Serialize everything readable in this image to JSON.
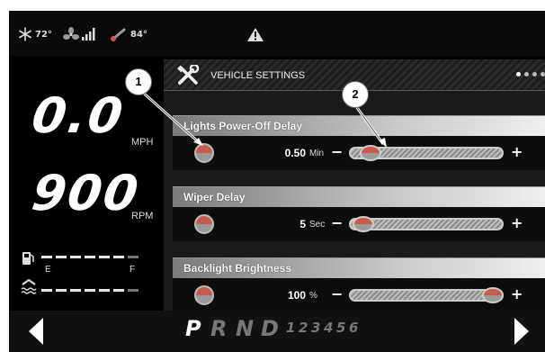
{
  "status_bar": {
    "cabin_temp": "72°",
    "outside_temp": "84°",
    "icons": [
      "snowflake-icon",
      "fan-icon",
      "signal-bars-icon",
      "thermometer-icon",
      "warning-icon"
    ]
  },
  "gauges": {
    "speed_value": "0.0",
    "speed_unit": "MPH",
    "rpm_value": "900",
    "rpm_unit": "RPM",
    "fuel_empty_label": "E",
    "fuel_full_label": "F"
  },
  "panel": {
    "title": "VEHICLE SETTINGS",
    "page_indicator_count": 4,
    "settings": [
      {
        "label": "Lights Power-Off Delay",
        "value": "0.50",
        "unit": "Min",
        "minus": "−",
        "plus": "+",
        "level": 0.08
      },
      {
        "label": "Wiper Delay",
        "value": "5",
        "unit": "Sec",
        "minus": "−",
        "plus": "+",
        "level": 0.03
      },
      {
        "label": "Backlight Brightness",
        "value": "100",
        "unit": "%",
        "minus": "−",
        "plus": "+",
        "level": 1.0
      }
    ]
  },
  "gear_selector": {
    "gears": [
      "P",
      "R",
      "N",
      "D",
      "1",
      "2",
      "3",
      "4",
      "5",
      "6"
    ],
    "selected": "P"
  },
  "callouts": [
    "1",
    "2"
  ],
  "colors": {
    "accent": "#c65b4c",
    "background": "#000000",
    "text": "#ffffff"
  }
}
